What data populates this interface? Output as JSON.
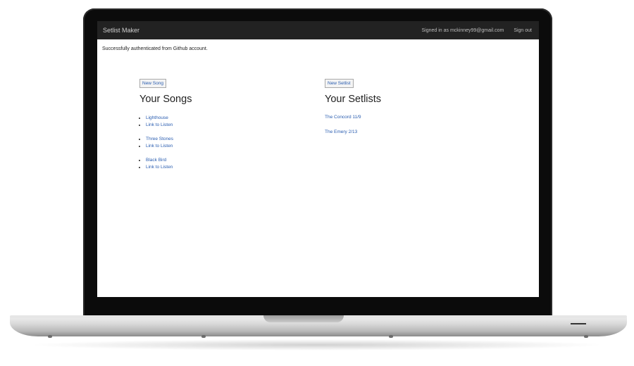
{
  "navbar": {
    "brand": "Setlist Maker",
    "signed_in": "Signed in as mckinney99@gmail.com",
    "sign_out": "Sign out"
  },
  "flash": "Successfully authenticated from Github account.",
  "songs": {
    "new_button": "New Song",
    "heading": "Your Songs",
    "items": [
      {
        "title": "Lighthouse",
        "listen": "Link to Listen"
      },
      {
        "title": "Three Stones",
        "listen": "Link to Listen"
      },
      {
        "title": "Black Bird",
        "listen": "Link to Listen"
      }
    ]
  },
  "setlists": {
    "new_button": "New Setlist",
    "heading": "Your Setlists",
    "items": [
      "The Concord 11/9",
      "The Emery 2/13"
    ]
  }
}
